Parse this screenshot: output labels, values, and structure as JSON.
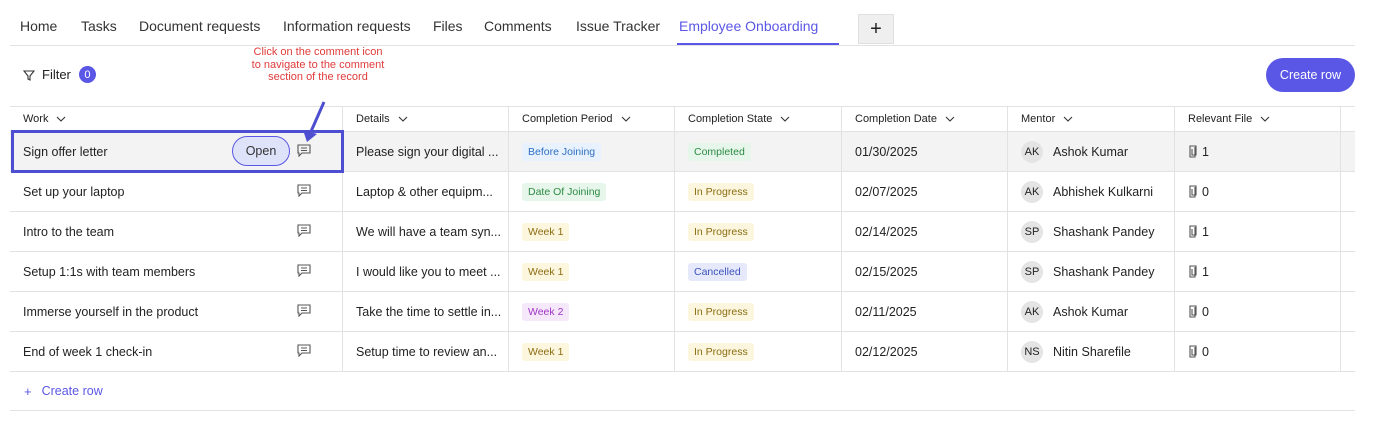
{
  "tabs": [
    {
      "label": "Home"
    },
    {
      "label": "Tasks"
    },
    {
      "label": "Document requests"
    },
    {
      "label": "Information requests"
    },
    {
      "label": "Files"
    },
    {
      "label": "Comments"
    },
    {
      "label": "Issue Tracker"
    },
    {
      "label": "Employee Onboarding"
    }
  ],
  "add_tab_label": "+",
  "filter": {
    "label": "Filter",
    "count": "0"
  },
  "annotation": "Click on the comment icon to navigate to the comment section of the record",
  "create_row_button": "Create row",
  "columns": [
    "Work",
    "Details",
    "Completion Period",
    "Completion State",
    "Completion Date",
    "Mentor",
    "Relevant File"
  ],
  "rows": [
    {
      "work": "Sign offer letter",
      "details": "Please sign your digital ...",
      "period": "Before Joining",
      "state": "Completed",
      "date": "01/30/2025",
      "mentor_initials": "AK",
      "mentor": "Ashok Kumar",
      "files": "1"
    },
    {
      "work": "Set up your laptop",
      "details": "Laptop & other equipm...",
      "period": "Date Of Joining",
      "state": "In Progress",
      "date": "02/07/2025",
      "mentor_initials": "AK",
      "mentor": "Abhishek Kulkarni",
      "files": "0"
    },
    {
      "work": "Intro to the team",
      "details": "We will have a team syn...",
      "period": "Week 1",
      "state": "In Progress",
      "date": "02/14/2025",
      "mentor_initials": "SP",
      "mentor": "Shashank Pandey",
      "files": "1"
    },
    {
      "work": "Setup 1:1s with team members",
      "details": "I would like you to meet ...",
      "period": "Week 1",
      "state": "Cancelled",
      "date": "02/15/2025",
      "mentor_initials": "SP",
      "mentor": "Shashank Pandey",
      "files": "1"
    },
    {
      "work": "Immerse yourself in the product",
      "details": "Take the time to settle in...",
      "period": "Week 2",
      "state": "In Progress",
      "date": "02/11/2025",
      "mentor_initials": "AK",
      "mentor": "Ashok Kumar",
      "files": "0"
    },
    {
      "work": "End of week 1 check-in",
      "details": "Setup time to review an...",
      "period": "Week 1",
      "state": "In Progress",
      "date": "02/12/2025",
      "mentor_initials": "NS",
      "mentor": "Nitin Sharefile",
      "files": "0"
    }
  ],
  "open_button": "Open",
  "bottom_create_row": "Create row",
  "colors": {
    "accent": "#5b57e6",
    "annotation": "#e03b3b",
    "highlight": "#4d4fd0"
  }
}
